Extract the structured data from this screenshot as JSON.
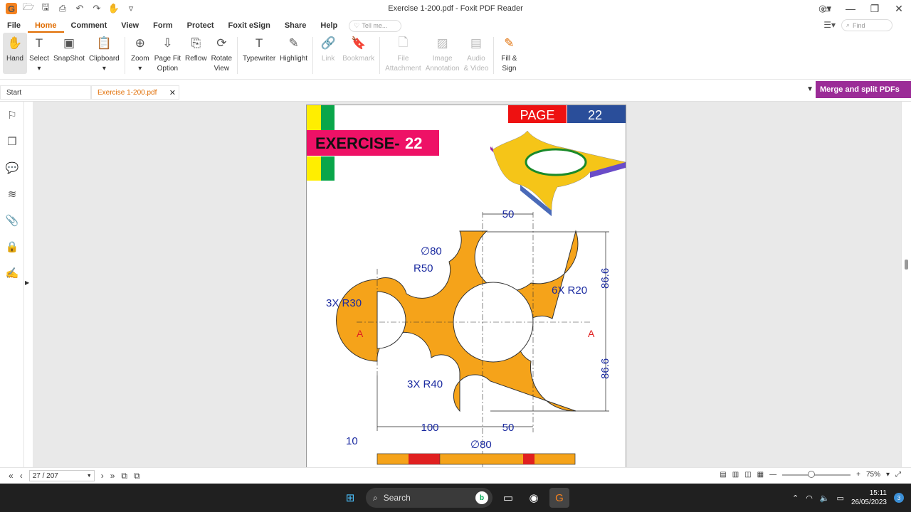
{
  "window": {
    "title": "Exercise 1-200.pdf - Foxit PDF Reader",
    "logo": "G"
  },
  "menu": {
    "items": [
      "File",
      "Home",
      "Comment",
      "View",
      "Form",
      "Protect",
      "Foxit eSign",
      "Share",
      "Help"
    ],
    "tell_me": "Tell me...",
    "find": "Find"
  },
  "ribbon": {
    "hand": "Hand",
    "select": "Select",
    "snapshot": "SnapShot",
    "clipboard": "Clipboard",
    "zoom": "Zoom",
    "page_fit_1": "Page Fit",
    "page_fit_2": "Option",
    "reflow": "Reflow",
    "rotate_1": "Rotate",
    "rotate_2": "View",
    "typewriter": "Typewriter",
    "highlight": "Highlight",
    "link": "Link",
    "bookmark": "Bookmark",
    "file_att_1": "File",
    "file_att_2": "Attachment",
    "image_ann_1": "Image",
    "image_ann_2": "Annotation",
    "audio_1": "Audio",
    "audio_2": "& Video",
    "fill_1": "Fill &",
    "fill_2": "Sign"
  },
  "tabs": {
    "start": "Start",
    "doc": "Exercise 1-200.pdf",
    "merge": "Merge and split PDFs"
  },
  "drawing": {
    "page_label": "PAGE",
    "page_number": "22",
    "exercise": "EXERCISE-",
    "exercise_number": "22",
    "dim_50_top": "50",
    "dim_phi80": "∅80",
    "dim_r50": "R50",
    "dim_3xr30": "3X R30",
    "dim_6xr20": "6X R20",
    "dim_3xr40": "3X R40",
    "dim_866_top": "86.6",
    "dim_866_bottom": "86.6",
    "dim_100": "100",
    "dim_50_bottom": "50",
    "dim_10": "10",
    "dim_phi80_bottom": "∅80",
    "section_left": "A",
    "section_right": "A"
  },
  "status": {
    "page": "27 / 207",
    "zoom": "75%"
  },
  "taskbar": {
    "search": "Search",
    "time": "15:11",
    "date": "26/05/2023",
    "notifications": "3"
  },
  "colors": {
    "accent": "#e06c00",
    "part": "#f5a31a",
    "merge": "#9b2c97",
    "dimension": "#1a2aa0",
    "section": "#e02020"
  }
}
